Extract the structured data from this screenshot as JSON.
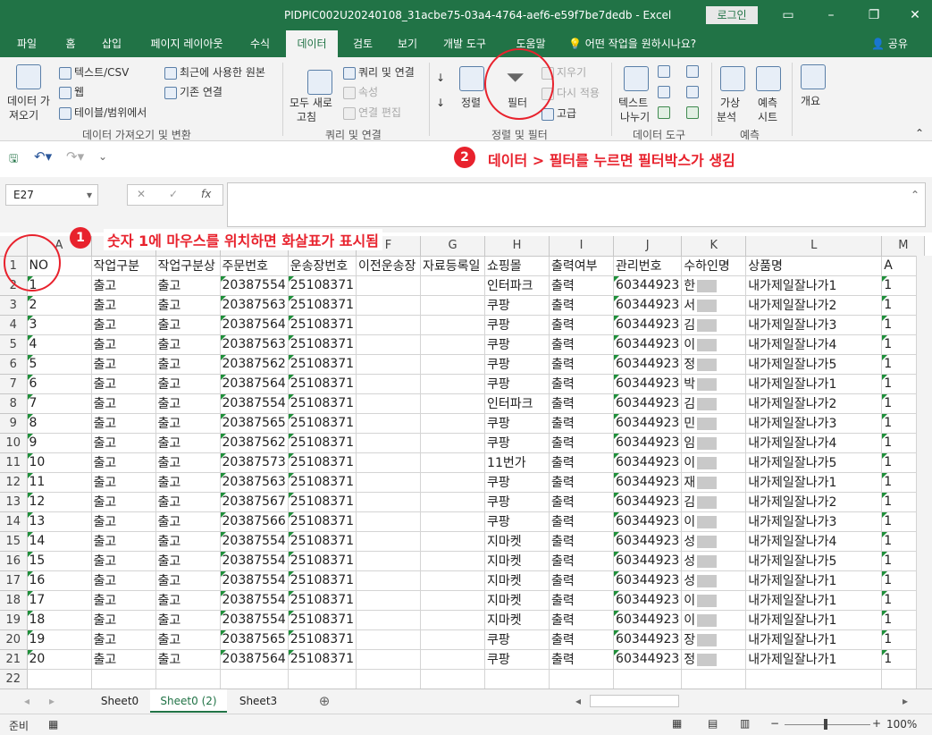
{
  "window": {
    "title": "PIDPIC002U20240108_31acbe75-03a4-4764-aef6-e59f7be7dedb  -  Excel",
    "login_label": "로그인"
  },
  "tabs": [
    "파일",
    "홈",
    "삽입",
    "페이지 레이아웃",
    "수식",
    "데이터",
    "검토",
    "보기",
    "개발 도구",
    "도움말"
  ],
  "tell_me": "어떤 작업을 원하시나요?",
  "share": "공유",
  "ribbon": {
    "get_data": "데이터 가",
    "get_data2": "져오기",
    "text_csv": "텍스트/CSV",
    "web": "웹",
    "table_range": "테이블/범위에서",
    "recent_sources": "최근에 사용한 원본",
    "existing_conn": "기존 연결",
    "group_get": "데이터 가져오기 및 변환",
    "refresh_all": "모두 새로",
    "refresh_all2": "고침",
    "queries_conn": "쿼리 및 연결",
    "properties": "속성",
    "edit_links": "연결 편집",
    "group_queries": "쿼리 및 연결",
    "sort": "정렬",
    "filter": "필터",
    "clear": "지우기",
    "reapply": "다시 적용",
    "advanced": "고급",
    "group_sort": "정렬 및 필터",
    "text_to_cols": "텍스트",
    "text_to_cols2": "나누기",
    "group_tools": "데이터 도구",
    "what_if": "가상",
    "what_if2": "분석",
    "forecast_sheet": "예측",
    "forecast_sheet2": "시트",
    "group_forecast": "예측",
    "outline": "개요"
  },
  "annotations": {
    "note1": "숫자 1에 마우스를 위치하면 화살표가 표시됨",
    "note2": "데이터 > 필터를 누르면 필터박스가 생김",
    "badge1": "1",
    "badge2": "2"
  },
  "formula_bar": {
    "name_box": "E27",
    "fx": "fx"
  },
  "grid": {
    "columns": [
      "A",
      "B",
      "C",
      "D",
      "E",
      "F",
      "G",
      "H",
      "I",
      "J",
      "K",
      "L",
      "M"
    ],
    "header_row": [
      "NO",
      "작업구분",
      "작업구분상",
      "주문번호",
      "운송장번호",
      "이전운송장",
      "자료등록일",
      "쇼핑몰",
      "출력여부",
      "관리번호",
      "수하인명",
      "상품명",
      "A"
    ],
    "rows": [
      [
        "1",
        "출고",
        "출고",
        "20387554",
        "25108371",
        "",
        "",
        "인터파크",
        "출력",
        "60344923",
        "한",
        "내가제일잘나가1",
        "1"
      ],
      [
        "2",
        "출고",
        "출고",
        "20387563",
        "25108371",
        "",
        "",
        "쿠팡",
        "출력",
        "60344923",
        "서",
        "내가제일잘나가2",
        "1"
      ],
      [
        "3",
        "출고",
        "출고",
        "20387564",
        "25108371",
        "",
        "",
        "쿠팡",
        "출력",
        "60344923",
        "김",
        "내가제일잘나가3",
        "1"
      ],
      [
        "4",
        "출고",
        "출고",
        "20387563",
        "25108371",
        "",
        "",
        "쿠팡",
        "출력",
        "60344923",
        "이",
        "내가제일잘나가4",
        "1"
      ],
      [
        "5",
        "출고",
        "출고",
        "20387562",
        "25108371",
        "",
        "",
        "쿠팡",
        "출력",
        "60344923",
        "정",
        "내가제일잘나가5",
        "1"
      ],
      [
        "6",
        "출고",
        "출고",
        "20387564",
        "25108371",
        "",
        "",
        "쿠팡",
        "출력",
        "60344923",
        "박",
        "내가제일잘나가1",
        "1"
      ],
      [
        "7",
        "출고",
        "출고",
        "20387554",
        "25108371",
        "",
        "",
        "인터파크",
        "출력",
        "60344923",
        "김",
        "내가제일잘나가2",
        "1"
      ],
      [
        "8",
        "출고",
        "출고",
        "20387565",
        "25108371",
        "",
        "",
        "쿠팡",
        "출력",
        "60344923",
        "민",
        "내가제일잘나가3",
        "1"
      ],
      [
        "9",
        "출고",
        "출고",
        "20387562",
        "25108371",
        "",
        "",
        "쿠팡",
        "출력",
        "60344923",
        "임",
        "내가제일잘나가4",
        "1"
      ],
      [
        "10",
        "출고",
        "출고",
        "20387573",
        "25108371",
        "",
        "",
        "11번가",
        "출력",
        "60344923",
        "이",
        "내가제일잘나가5",
        "1"
      ],
      [
        "11",
        "출고",
        "출고",
        "20387563",
        "25108371",
        "",
        "",
        "쿠팡",
        "출력",
        "60344923",
        "재",
        "내가제일잘나가1",
        "1"
      ],
      [
        "12",
        "출고",
        "출고",
        "20387567",
        "25108371",
        "",
        "",
        "쿠팡",
        "출력",
        "60344923",
        "김",
        "내가제일잘나가2",
        "1"
      ],
      [
        "13",
        "출고",
        "출고",
        "20387566",
        "25108371",
        "",
        "",
        "쿠팡",
        "출력",
        "60344923",
        "이",
        "내가제일잘나가3",
        "1"
      ],
      [
        "14",
        "출고",
        "출고",
        "20387554",
        "25108371",
        "",
        "",
        "지마켓",
        "출력",
        "60344923",
        "성",
        "내가제일잘나가4",
        "1"
      ],
      [
        "15",
        "출고",
        "출고",
        "20387554",
        "25108371",
        "",
        "",
        "지마켓",
        "출력",
        "60344923",
        "성",
        "내가제일잘나가5",
        "1"
      ],
      [
        "16",
        "출고",
        "출고",
        "20387554",
        "25108371",
        "",
        "",
        "지마켓",
        "출력",
        "60344923",
        "성",
        "내가제일잘나가1",
        "1"
      ],
      [
        "17",
        "출고",
        "출고",
        "20387554",
        "25108371",
        "",
        "",
        "지마켓",
        "출력",
        "60344923",
        "이",
        "내가제일잘나가1",
        "1"
      ],
      [
        "18",
        "출고",
        "출고",
        "20387554",
        "25108371",
        "",
        "",
        "지마켓",
        "출력",
        "60344923",
        "이",
        "내가제일잘나가1",
        "1"
      ],
      [
        "19",
        "출고",
        "출고",
        "20387565",
        "25108371",
        "",
        "",
        "쿠팡",
        "출력",
        "60344923",
        "장",
        "내가제일잘나가1",
        "1"
      ],
      [
        "20",
        "출고",
        "출고",
        "20387564",
        "25108371",
        "",
        "",
        "쿠팡",
        "출력",
        "60344923",
        "정",
        "내가제일잘나가1",
        "1"
      ]
    ]
  },
  "sheets": [
    "Sheet0",
    "Sheet0 (2)",
    "Sheet3"
  ],
  "status": {
    "ready": "준비",
    "zoom": "100%"
  },
  "colors": {
    "excel_green": "#217346",
    "annotation_red": "#e8222d"
  }
}
